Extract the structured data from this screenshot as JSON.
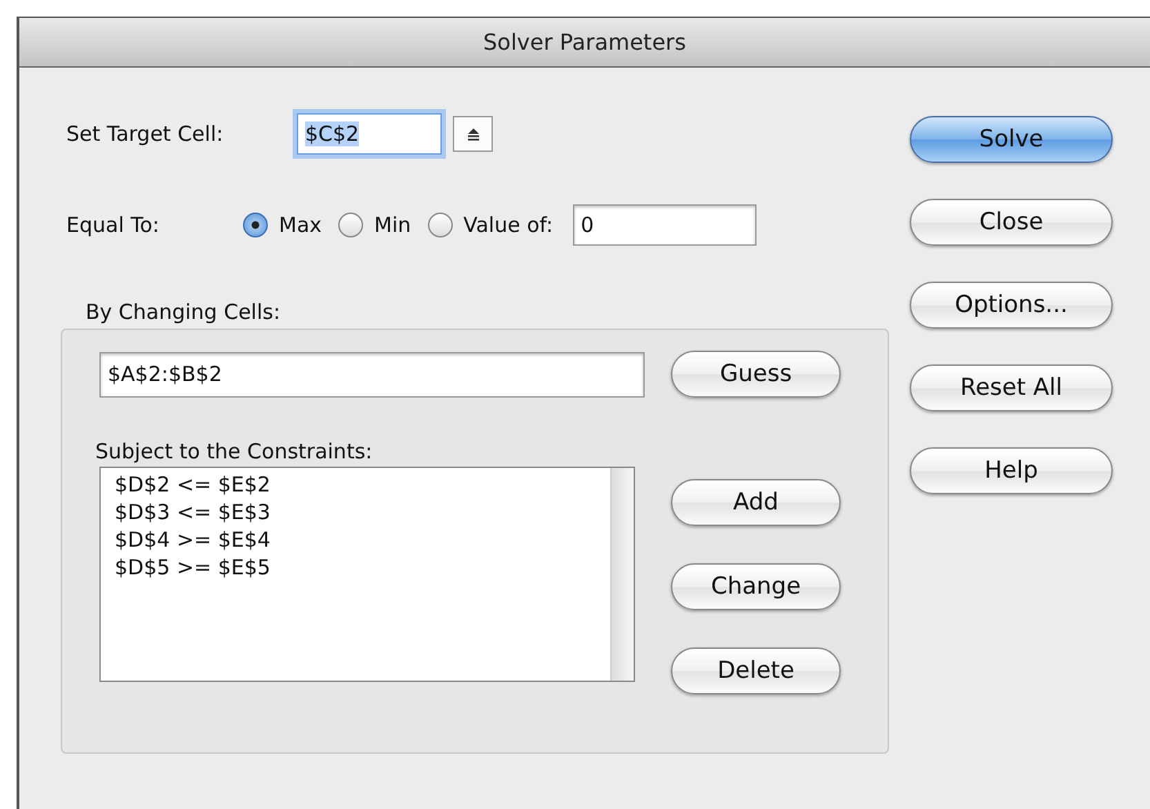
{
  "window": {
    "title": "Solver Parameters"
  },
  "target": {
    "label": "Set Target Cell:",
    "value": "$C$2"
  },
  "equal_to": {
    "label": "Equal To:",
    "options": [
      {
        "label": "Max",
        "selected": true
      },
      {
        "label": "Min",
        "selected": false
      },
      {
        "label": "Value of:",
        "selected": false
      }
    ],
    "value": "0"
  },
  "changing": {
    "label": "By Changing Cells:",
    "value": "$A$2:$B$2",
    "button": "Guess"
  },
  "constraints": {
    "label": "Subject to the Constraints:",
    "items": [
      "$D$2 <= $E$2",
      "$D$3 <= $E$3",
      "$D$4 >= $E$4",
      "$D$5 >= $E$5"
    ],
    "buttons": [
      "Add",
      "Change",
      "Delete"
    ]
  },
  "buttons": [
    {
      "label": "Solve",
      "default": true
    },
    {
      "label": "Close",
      "default": false
    },
    {
      "label": "Options...",
      "default": false
    },
    {
      "label": "Reset All",
      "default": false
    },
    {
      "label": "Help",
      "default": false
    }
  ]
}
